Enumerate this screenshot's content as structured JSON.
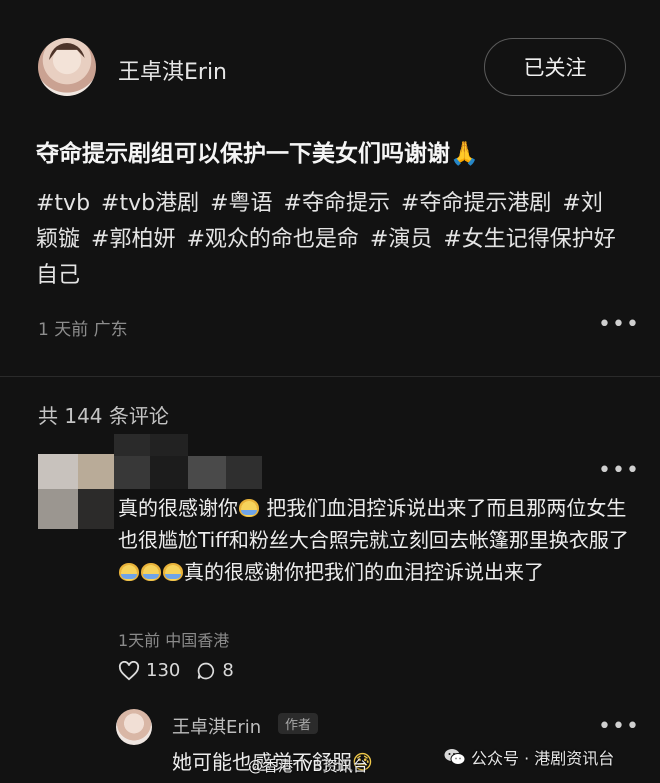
{
  "header": {
    "username": "王卓淇Erin",
    "follow_label": "已关注"
  },
  "post": {
    "title": "夺命提示剧组可以保护一下美女们吗谢谢",
    "title_emoji": "🙏",
    "tags": [
      "#tvb",
      "#tvb港剧",
      "#粤语",
      "#夺命提示",
      "#夺命提示港剧",
      "#刘颖镟",
      "#郭柏妍",
      "#观众的命也是命",
      "#演员",
      "#女生记得保护好自己"
    ],
    "time": "1 天前",
    "location": "广东"
  },
  "comments_header": "共 144 条评论",
  "comment": {
    "text_1": "真的很感谢你",
    "text_2": " 把我们血泪控诉说出来了而且那两位女生也很尴尬Tiff和粉丝大合照完就立刻回去帐篷那里换衣服了",
    "text_3": "真的很感谢你把我们的血泪控诉说出来了",
    "time": "1天前",
    "location": "中国香港",
    "likes": "130",
    "replies": "8"
  },
  "reply": {
    "username": "王卓淇Erin",
    "badge": "作者",
    "text": "她可能也感觉不舒服",
    "emoji": "😓"
  },
  "watermarks": {
    "weibo": "@香港TVB资讯台",
    "wechat": "公众号 · 港剧资讯台"
  },
  "icons": {
    "more": "more-horizontal-icon",
    "like": "heart-icon",
    "reply": "comment-bubble-icon",
    "wechat": "wechat-icon"
  }
}
